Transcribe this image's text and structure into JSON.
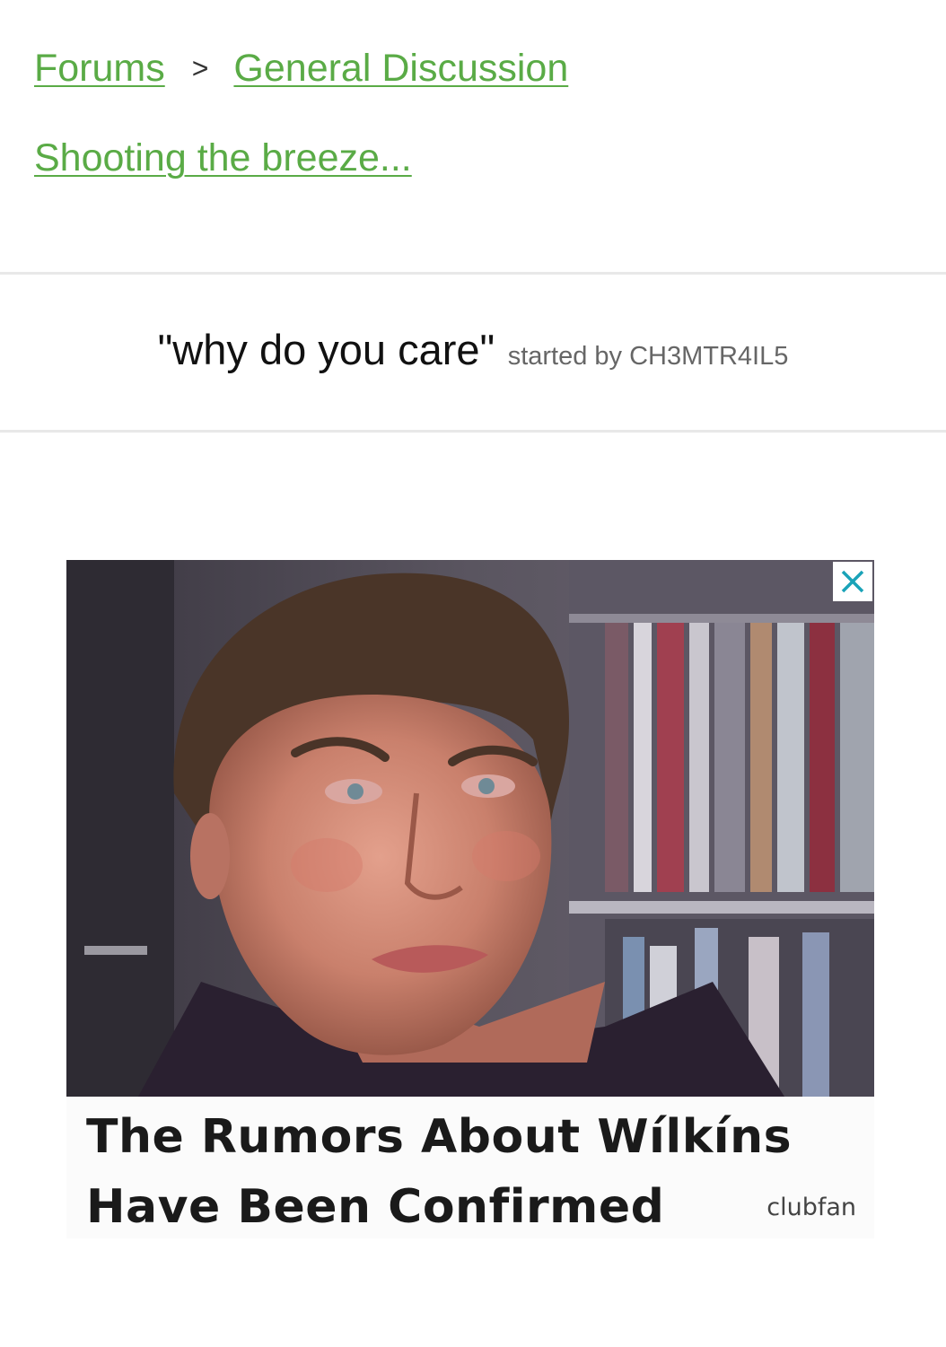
{
  "breadcrumb": {
    "forums_label": "Forums",
    "separator": ">",
    "category_label": "General Discussion"
  },
  "subforum": {
    "label": "Shooting the breeze..."
  },
  "thread": {
    "title": "\"why do you care\"",
    "started_by": "started by CH3MTR4IL5"
  },
  "ad": {
    "headline_line1": "The Rumors About Wílkíns",
    "headline_line2": "Have Been Confirmed",
    "sponsor": "clubfan",
    "close_icon": "close-icon",
    "close_color": "#1aa3b8"
  },
  "colors": {
    "link": "#5aab46",
    "divider": "#e8e8e8"
  }
}
